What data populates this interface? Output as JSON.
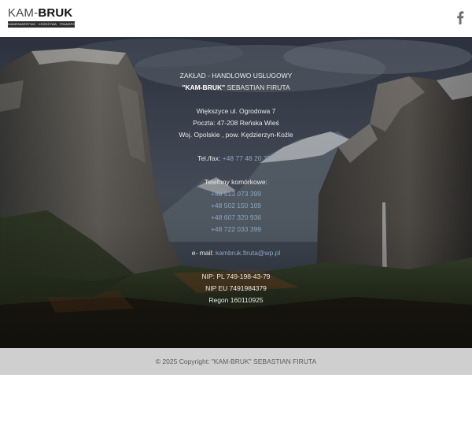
{
  "header": {
    "logo": {
      "word_light": "KAM-",
      "word_bold": "BRUK",
      "tagline": "KAMIENIARSTWO · KRZEŻYWA · TRANSPORT"
    },
    "facebook_icon": "facebook-icon"
  },
  "company": {
    "type": "ZAKŁAD - HANDLOWO USŁUGOWY",
    "name": "\"KAM-BRUK\"",
    "owner": " SEBASTIAN FIRUTA"
  },
  "address": {
    "street": "Większyce ul. Ogrodowa 7",
    "postal": "Poczta: 47-208 Reńska Wieś",
    "region": "Woj. Opolskie , pow. Kędzierzyn-Koźle"
  },
  "phone": {
    "label": "Tel./fax: ",
    "number": "+48 77 48 20 333"
  },
  "mobiles": {
    "label": "Telefony komórkowe:",
    "numbers": [
      "+48 513 073 399",
      "+48 502 150 109",
      "+48 607 320 936",
      "+48 722 033 399"
    ]
  },
  "email": {
    "label": "e- mail: ",
    "address": "kambruk.firuta@wp.pl"
  },
  "registry": {
    "nip_pl": "NIP: PL 749-198-43-79",
    "nip_eu": "NIP EU 7491984379",
    "regon": "Regon 160110925"
  },
  "footer": {
    "copyright": "© 2025 Copyright: \"KAM-BRUK\" SEBASTIAN FIRUTA"
  },
  "colors": {
    "link": "#8aa6c2",
    "footer_bg": "#cfcfcf",
    "header_bg": "#ffffff"
  }
}
